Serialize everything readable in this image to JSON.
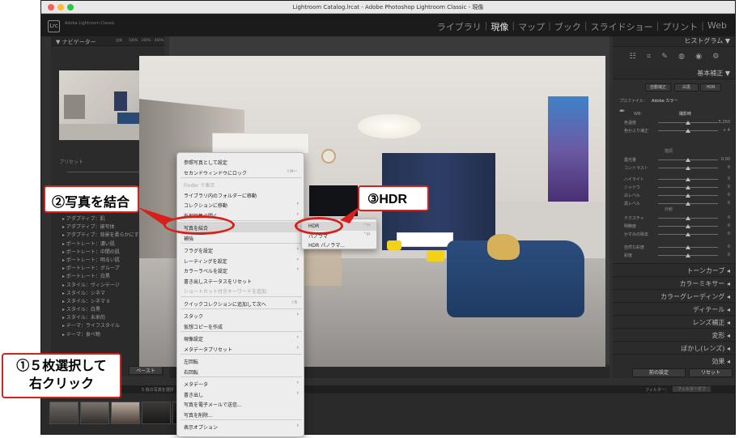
{
  "window_title": "Lightroom Catalog.lrcat - Adobe Photoshop Lightroom Classic - 現像",
  "app": {
    "logo": "Lrc",
    "name": "Adobe Lightroom Classic"
  },
  "modules": [
    "ライブラリ",
    "現像",
    "マップ",
    "ブック",
    "スライドショー",
    "プリント",
    "Web"
  ],
  "active_module": "現像",
  "left_panel": {
    "navigator_title": "ナビゲーター",
    "navigator_zoom": [
      "全体",
      "100%",
      "200%",
      "400%"
    ],
    "preset_label": "プリセット",
    "presets": [
      "アダプティブ：肌",
      "アダプティブ：被写体",
      "アダプティブ：背景を柔らかにする",
      "ポートレート：濃い肌",
      "ポートレート：中間の肌",
      "ポートレート：明るい肌",
      "ポートレート：グループ",
      "ポートレート：白黒",
      "スタイル：ヴィンテージ",
      "スタイル：シネマ",
      "スタイル：シネマ II",
      "スタイル：白黒",
      "スタイル：未来的",
      "テーマ：ライフスタイル",
      "テーマ：食べ物"
    ],
    "paste_button": "ペースト"
  },
  "right_panel": {
    "histogram": "ヒストグラム",
    "basic": "基本補正",
    "treatment_buttons": [
      "自動補正",
      "白黒",
      "HDR"
    ],
    "profile_label": "プロファイル：",
    "profile_value": "Adobe カラー",
    "wb_label": "WB：",
    "wb_value": "撮影時",
    "tone_label": "階調",
    "presence_label": "外観",
    "sliders": [
      {
        "label": "色温度",
        "value": "5,250"
      },
      {
        "label": "色かぶり補正",
        "value": "+ 4"
      },
      {
        "label": "露光量",
        "value": "0.00"
      },
      {
        "label": "コントラスト",
        "value": "0"
      },
      {
        "label": "ハイライト",
        "value": "0"
      },
      {
        "label": "シャドウ",
        "value": "0"
      },
      {
        "label": "白レベル",
        "value": "0"
      },
      {
        "label": "黒レベル",
        "value": "0"
      },
      {
        "label": "テクスチャ",
        "value": "0"
      },
      {
        "label": "明瞭度",
        "value": "0"
      },
      {
        "label": "かすみの除去",
        "value": "0"
      },
      {
        "label": "自然な彩度",
        "value": "0"
      },
      {
        "label": "彩度",
        "value": "0"
      }
    ],
    "collapsed_panels": [
      "トーンカーブ",
      "カラーミキサー",
      "カラーグレーディング",
      "ディテール",
      "レンズ補正",
      "変形",
      "ぼかし(レンズ)",
      "効果"
    ],
    "bottom_buttons": [
      "前の設定",
      "リセット"
    ]
  },
  "filmstrip": {
    "filter_label": "フィルター：",
    "filter_value": "フィルターオフ",
    "info": "5 枚の写真を選択"
  },
  "context_menu": {
    "items": [
      {
        "label": "参照写真として設定",
        "enabled": true
      },
      {
        "label": "セカンドウィンドウにロック",
        "shortcut": "⇧⌘↩",
        "enabled": true
      },
      {
        "label": "Finder で表示",
        "enabled": false
      },
      {
        "label": "ライブラリ内のフォルダーに移動",
        "enabled": true
      },
      {
        "label": "コレクションに移動",
        "arrow": true,
        "enabled": true
      },
      {
        "label": "外部編集で開く",
        "arrow": true,
        "enabled": true
      },
      {
        "label": "写真を結合",
        "arrow": true,
        "enabled": true,
        "selected": true
      },
      {
        "label": "補強",
        "enabled": true
      },
      {
        "label": "フラグを設定",
        "arrow": true,
        "enabled": true
      },
      {
        "label": "レーティングを設定",
        "arrow": true,
        "enabled": true
      },
      {
        "label": "カラーラベルを設定",
        "arrow": true,
        "enabled": true
      },
      {
        "label": "書き出しステータスをリセット",
        "enabled": true
      },
      {
        "label": "ショートカット付きキーワードを追加",
        "enabled": false
      },
      {
        "label": "クイックコレクションに追加して次へ",
        "shortcut": "⇧B",
        "enabled": true
      },
      {
        "label": "スタック",
        "arrow": true,
        "enabled": true
      },
      {
        "label": "仮想コピーを作成",
        "enabled": true
      },
      {
        "label": "現像設定",
        "arrow": true,
        "enabled": true
      },
      {
        "label": "メタデータプリセット",
        "arrow": true,
        "enabled": true
      },
      {
        "label": "左回転",
        "enabled": true
      },
      {
        "label": "右回転",
        "enabled": true
      },
      {
        "label": "メタデータ",
        "arrow": true,
        "enabled": true
      },
      {
        "label": "書き出し",
        "arrow": true,
        "enabled": true
      },
      {
        "label": "写真を電子メールで送信...",
        "enabled": true
      },
      {
        "label": "写真を削除...",
        "enabled": true
      },
      {
        "label": "表示オプション",
        "arrow": true,
        "enabled": true
      }
    ]
  },
  "submenu": {
    "items": [
      {
        "label": "HDR",
        "shortcut": "^H",
        "selected": true
      },
      {
        "label": "パノラマ",
        "shortcut": "^M"
      },
      {
        "label": "HDR パノラマ..."
      }
    ]
  },
  "annotations": {
    "step1_line1": "①５枚選択して",
    "step1_line2": "右クリック",
    "step2": "②写真を結合",
    "step3": "③HDR"
  },
  "colors": {
    "annotation_red": "#d7201c",
    "lr_background": "#303030",
    "menu_background": "#ededed"
  }
}
